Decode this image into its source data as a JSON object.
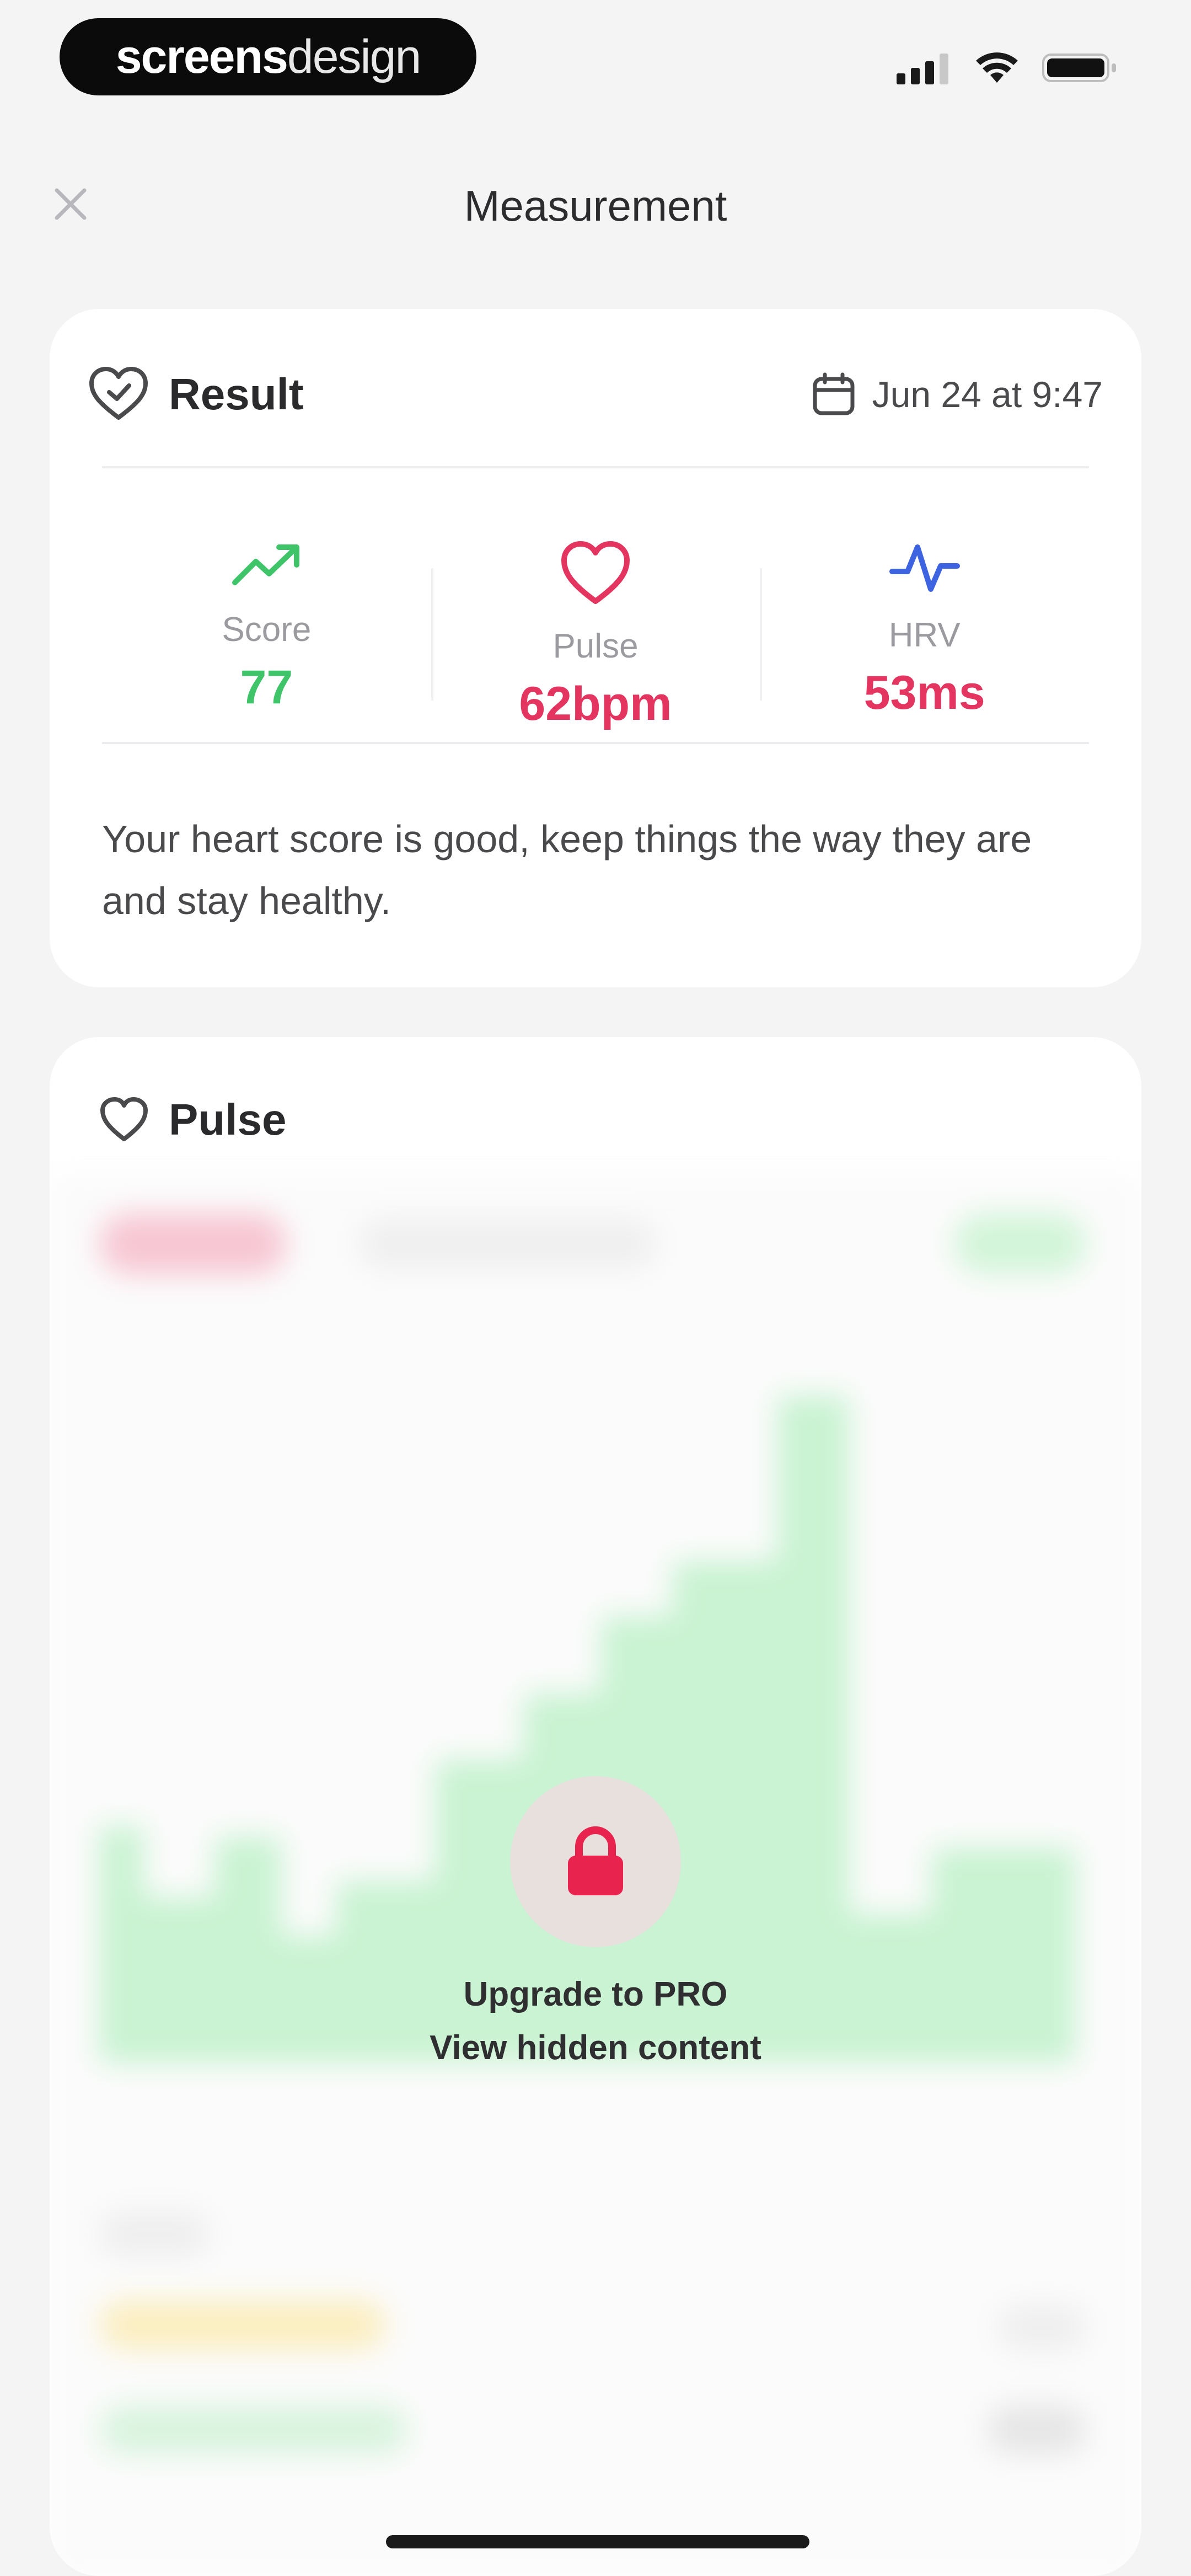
{
  "status_bar": {
    "brand_bold": "screens",
    "brand_light": "design",
    "icons": [
      "signal-icon",
      "wifi-icon",
      "battery-icon"
    ]
  },
  "nav": {
    "close_icon": "close-icon",
    "title": "Measurement"
  },
  "result": {
    "title": "Result",
    "date": "Jun 24 at 9:47",
    "metrics": [
      {
        "label": "Score",
        "value": "77",
        "color": "#3fc46a",
        "icon": "trend-up-icon"
      },
      {
        "label": "Pulse",
        "value": "62bpm",
        "color": "#e3355f",
        "icon": "heart-icon"
      },
      {
        "label": "HRV",
        "value": "53ms",
        "color": "#e3355f",
        "icon": "pulse-wave-icon",
        "icon_color": "#3d63e0"
      }
    ],
    "description": "Your heart score is good, keep things the way they are and stay healthy."
  },
  "pulse": {
    "title": "Pulse",
    "lock_line1": "Upgrade to PRO",
    "lock_line2": "View hidden content",
    "accent": "#e8234d"
  }
}
